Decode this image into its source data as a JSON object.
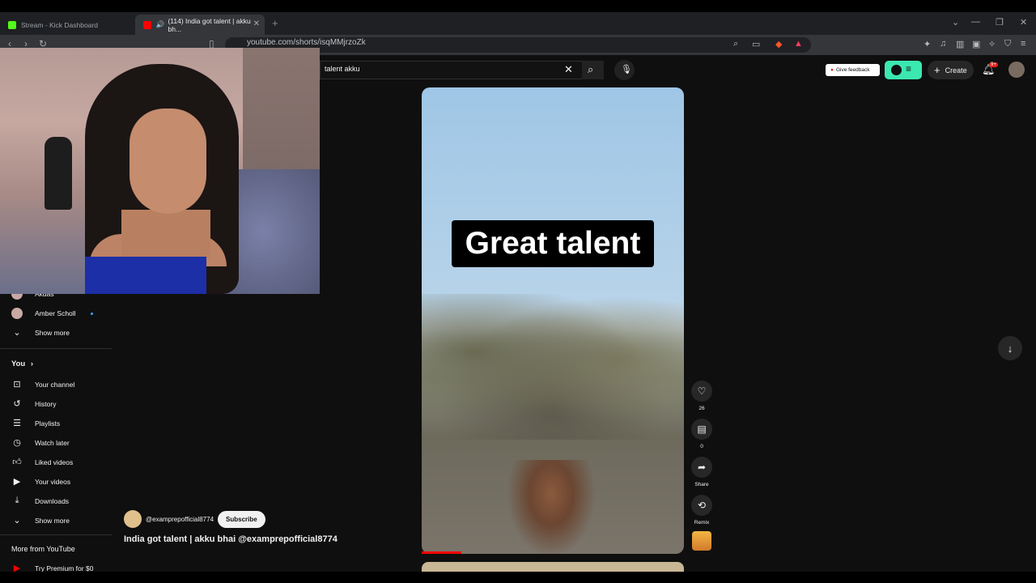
{
  "browser": {
    "tabs": [
      {
        "title": "Stream - Kick Dashboard",
        "active": false,
        "favicon_color": "#53fc18"
      },
      {
        "title": "(114) India got talent | akku bh...",
        "active": true,
        "favicon_color": "#ff0000"
      }
    ],
    "url": "youtube.com/shorts/isqMMjrzoZk"
  },
  "header": {
    "search_value": "talent akku",
    "feedback_label": "Give feedback",
    "create_label": "Create",
    "notification_count": "9+"
  },
  "sidebar": {
    "subscriptions": [
      {
        "label": "Akdas"
      },
      {
        "label": "Amber Scholl"
      }
    ],
    "show_more_1": "Show more",
    "you_heading": "You",
    "you_items": [
      {
        "label": "Your channel",
        "icon": "person-box-icon"
      },
      {
        "label": "History",
        "icon": "history-icon"
      },
      {
        "label": "Playlists",
        "icon": "playlists-icon"
      },
      {
        "label": "Watch later",
        "icon": "clock-icon"
      },
      {
        "label": "Liked videos",
        "icon": "thumbs-up-icon"
      },
      {
        "label": "Your videos",
        "icon": "video-icon"
      },
      {
        "label": "Downloads",
        "icon": "download-icon"
      }
    ],
    "show_more_2": "Show more",
    "more_heading": "More from YouTube",
    "premium_label": "Try Premium for $0"
  },
  "short": {
    "caption": "Great talent",
    "channel": "@examprepofficial8774",
    "subscribe_label": "Subscribe",
    "title": "India got talent | akku bhai @examprepofficial8774",
    "likes": "26",
    "comments": "0",
    "share_label": "Share",
    "remix_label": "Remix",
    "progress": 0.15
  },
  "colors": {
    "page_bg": "#0f0f0f",
    "accent_red": "#ff0000",
    "extension_green": "#3be8b0"
  }
}
